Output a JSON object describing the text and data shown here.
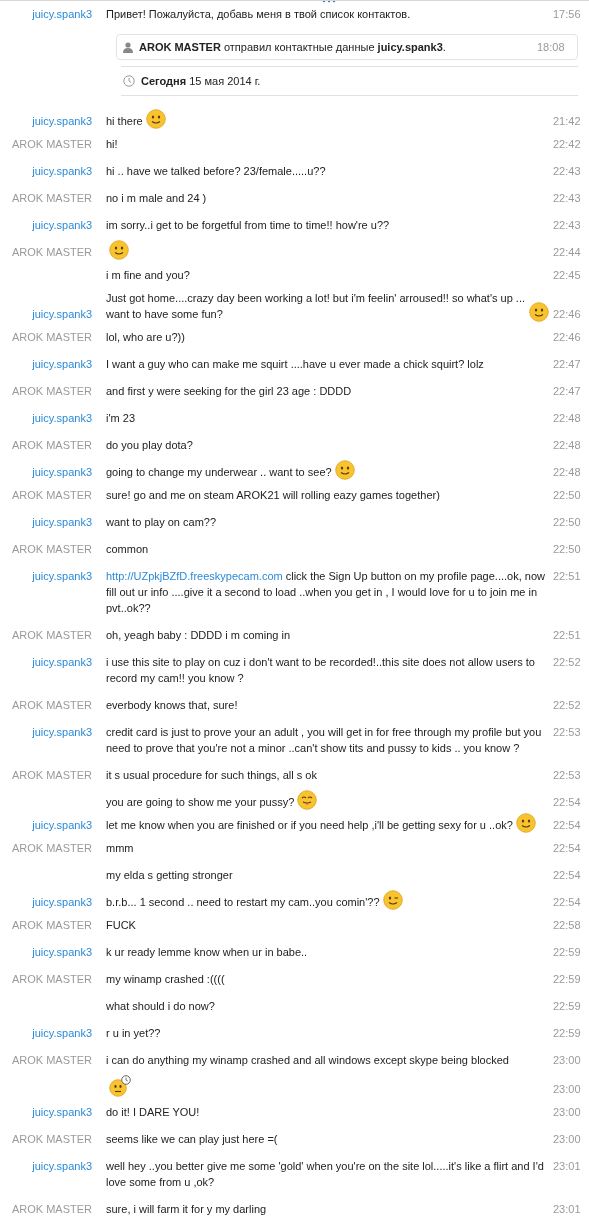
{
  "intro": {
    "sender": "juicy.spank3",
    "kind": "contact",
    "text": "Привет! Пожалуйста, добавь меня в твой список контактов.",
    "time": "17:56"
  },
  "contact_notice": {
    "text": "**AROK MASTER** отправил контактные данные **juicy.spank3**.",
    "time": "18:08"
  },
  "date_divider": {
    "text": "**Сегодня** 15 мая 2014 г."
  },
  "messages": [
    {
      "sender": "juicy.spank3",
      "kind": "contact",
      "text": "hi there",
      "time": "21:42",
      "emoticon": {
        "kind": "smile"
      }
    },
    {
      "sender": "AROK MASTER",
      "kind": "own",
      "text": "hi!",
      "time": "22:42"
    },
    {
      "sender": "juicy.spank3",
      "kind": "contact",
      "text": "hi  .. have we talked before? 23/female.....u??",
      "time": "22:43"
    },
    {
      "sender": "AROK MASTER",
      "kind": "own",
      "text": "no i m male and 24 )",
      "time": "22:43"
    },
    {
      "sender": "juicy.spank3",
      "kind": "contact",
      "text": "im sorry..i get to be forgetful from time to time!! how're u??",
      "time": "22:43"
    },
    {
      "sender": "AROK MASTER",
      "kind": "own",
      "time": "22:44",
      "emoticon": {
        "kind": "smile"
      }
    },
    {
      "text": "i m fine and you?",
      "time": "22:45"
    },
    {
      "sender": "juicy.spank3",
      "kind": "contact",
      "text": "Just got home....crazy day been working a lot! but i'm feelin' arroused!! so what's up ... want to have some fun?",
      "time": "22:46",
      "emoticon": {
        "kind": "smile"
      }
    },
    {
      "sender": "AROK MASTER",
      "kind": "own",
      "text": "lol, who are u?))",
      "time": "22:46"
    },
    {
      "sender": "juicy.spank3",
      "kind": "contact",
      "text": "I want a guy who can make me squirt ....have u ever made a chick squirt? lolz",
      "time": "22:47"
    },
    {
      "sender": "AROK MASTER",
      "kind": "own",
      "text": "and first y were seeking for the girl 23 age : DDDD",
      "time": "22:47"
    },
    {
      "sender": "juicy.spank3",
      "kind": "contact",
      "text": "i'm 23",
      "time": "22:48"
    },
    {
      "sender": "AROK MASTER",
      "kind": "own",
      "text": "do you play dota?",
      "time": "22:48"
    },
    {
      "sender": "juicy.spank3",
      "kind": "contact",
      "text": "going to change my underwear .. want to see?",
      "time": "22:48",
      "emoticon": {
        "kind": "smile"
      }
    },
    {
      "sender": "AROK MASTER",
      "kind": "own",
      "text": "sure! go and me on steam AROK21 will rolling eazy games together)",
      "time": "22:50"
    },
    {
      "sender": "juicy.spank3",
      "kind": "contact",
      "text": "want to play on cam??",
      "time": "22:50"
    },
    {
      "sender": "AROK MASTER",
      "kind": "own",
      "text": "common",
      "time": "22:50"
    },
    {
      "sender": "juicy.spank3",
      "kind": "contact",
      "link": "http://UZpkjBZfD.freeskypecam.com",
      "text": "click the Sign Up button on my profile page....ok,   now fill out ur info ....give it a second to load ..when you get in , I would love for u to join me in pvt..ok??",
      "time": "22:51"
    },
    {
      "sender": "AROK MASTER",
      "kind": "own",
      "text": "oh, yeagh baby : DDDD i m coming in",
      "time": "22:51"
    },
    {
      "sender": "juicy.spank3",
      "kind": "contact",
      "text": "i use this site to play on cuz i don't want to be recorded!..this site does not allow users to record my cam!! you know ?",
      "time": "22:52"
    },
    {
      "sender": "AROK MASTER",
      "kind": "own",
      "text": "everbody knows that, sure!",
      "time": "22:52"
    },
    {
      "sender": "juicy.spank3",
      "kind": "contact",
      "text": "credit card is just to prove your an adult , you will get in for free through my profile but you need to prove that you're not a minor  ..can't show tits and pussy to kids .. you know ?",
      "time": "22:53"
    },
    {
      "sender": "AROK MASTER",
      "kind": "own",
      "text": "it s usual procedure for such things, all s ok",
      "time": "22:53"
    },
    {
      "text": "you are going to show me your pussy?",
      "time": "22:54",
      "emoticon": {
        "kind": "tongue"
      }
    },
    {
      "sender": "juicy.spank3",
      "kind": "contact",
      "text": "let me know when you are finished or if you need help ,i'll be getting sexy for u ..ok?",
      "time": "22:54",
      "emoticon": {
        "kind": "smile"
      }
    },
    {
      "sender": "AROK MASTER",
      "kind": "own",
      "text": "mmm",
      "time": "22:54"
    },
    {
      "text": "my elda s getting stronger",
      "time": "22:54"
    },
    {
      "sender": "juicy.spank3",
      "kind": "contact",
      "text": "b.r.b... 1 second .. need to restart my cam..you comin'??",
      "time": "22:54",
      "emoticon": {
        "kind": "wink"
      }
    },
    {
      "sender": "AROK MASTER",
      "kind": "own",
      "text": "FUCK",
      "time": "22:58"
    },
    {
      "sender": "juicy.spank3",
      "kind": "contact",
      "text": "k ur ready lemme know when ur in babe..",
      "time": "22:59"
    },
    {
      "sender": "AROK MASTER",
      "kind": "own",
      "text": "my winamp crashed :((((",
      "time": "22:59"
    },
    {
      "text": "what should i do now?",
      "time": "22:59"
    },
    {
      "sender": "juicy.spank3",
      "kind": "contact",
      "text": "r u in yet??",
      "time": "22:59"
    },
    {
      "sender": "AROK MASTER",
      "kind": "own",
      "text": "i can do anything my winamp crashed and all windows except skype being blocked",
      "time": "23:00"
    },
    {
      "time": "23:00",
      "emoticon": {
        "kind": "waiting"
      }
    },
    {
      "sender": "juicy.spank3",
      "kind": "contact",
      "text": "do it! I DARE YOU!",
      "time": "23:00"
    },
    {
      "sender": "AROK MASTER",
      "kind": "own",
      "text": "seems like we can play just here =(",
      "time": "23:00"
    },
    {
      "sender": "juicy.spank3",
      "kind": "contact",
      "text": "well hey  ..you better give me some 'gold' when you're on the site lol.....it's like a flirt and I'd love some from u  ,ok?",
      "time": "23:01"
    },
    {
      "sender": "AROK MASTER",
      "kind": "own",
      "text": "sure, i will farm it for y my darling",
      "time": "23:01"
    }
  ]
}
